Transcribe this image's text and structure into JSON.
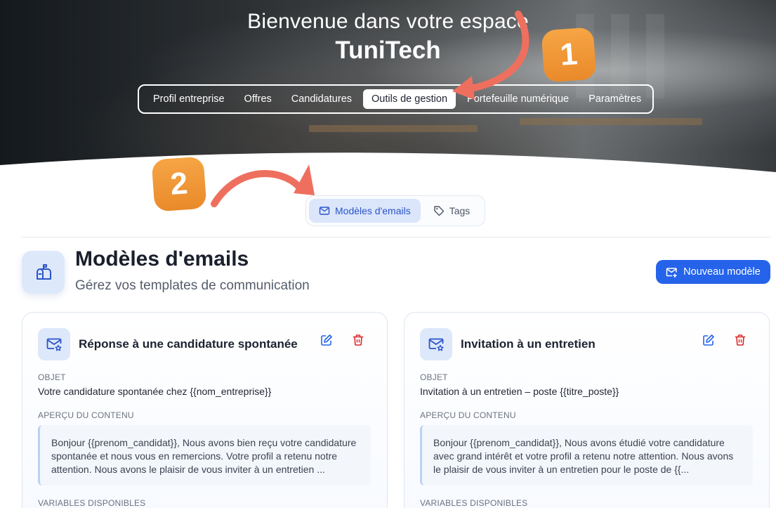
{
  "hero": {
    "title": "Bienvenue dans votre espace",
    "company": "TuniTech"
  },
  "main_nav": {
    "items": [
      {
        "label": "Profil entreprise"
      },
      {
        "label": "Offres"
      },
      {
        "label": "Candidatures"
      },
      {
        "label": "Outils de gestion",
        "active": true
      },
      {
        "label": "Portefeuille numérique"
      },
      {
        "label": "Paramètres"
      }
    ]
  },
  "callouts": {
    "step1": "1",
    "step2": "2",
    "accent_color": "#f0973a",
    "arrow_color": "#ef6f5e"
  },
  "sub_tabs": {
    "email_templates": "Modèles d'emails",
    "tags": "Tags"
  },
  "section": {
    "title": "Modèles d'emails",
    "subtitle": "Gérez vos templates de communication",
    "new_button": "Nouveau modèle"
  },
  "cards": [
    {
      "title": "Réponse à une candidature spontanée",
      "subject_label": "OBJET",
      "subject": "Votre candidature spontanée chez {{nom_entreprise}}",
      "preview_label": "APERÇU DU CONTENU",
      "preview": "Bonjour {{prenom_candidat}}, Nous avons bien reçu votre candidature spontanée et nous vous en remercions. Votre profil a retenu notre attention. Nous avons le plaisir de vous inviter à un entretien ...",
      "variables_label": "VARIABLES DISPONIBLES"
    },
    {
      "title": "Invitation à un entretien",
      "subject_label": "OBJET",
      "subject": "Invitation à un entretien – poste {{titre_poste}}",
      "preview_label": "APERÇU DU CONTENU",
      "preview": "Bonjour {{prenom_candidat}}, Nous avons étudié votre candidature avec grand intérêt et votre profil a retenu notre attention. Nous avons le plaisir de vous inviter à un entretien pour le poste de {{...",
      "variables_label": "VARIABLES DISPONIBLES"
    }
  ],
  "colors": {
    "primary": "#2563eb",
    "danger": "#dc2626",
    "icon_bg": "#dde8fb"
  }
}
